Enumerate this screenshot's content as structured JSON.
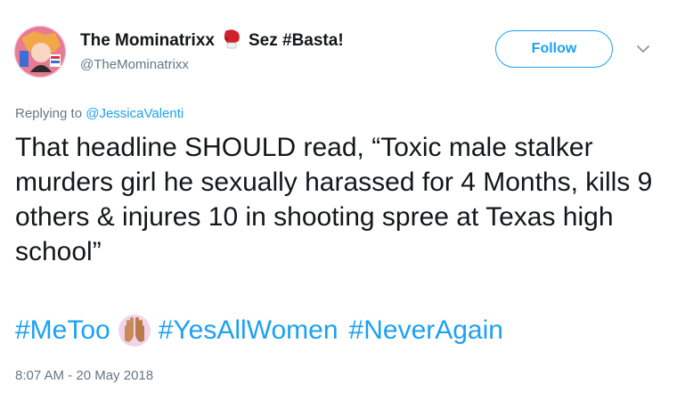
{
  "author": {
    "display_name": "The Mominatrixx",
    "name_suffix": "Sez #Basta!",
    "handle": "@TheMominatrixx",
    "avatar_icon": "avatar-woman-photo",
    "name_emoji_icon": "boxing-glove-icon"
  },
  "follow_button": {
    "label": "Follow"
  },
  "menu": {
    "icon": "chevron-down-icon"
  },
  "reply": {
    "prefix": "Replying to",
    "mention": "@JessicaValenti"
  },
  "tweet": {
    "text": "That headline SHOULD read, “Toxic male stalker murders girl he sexually harassed for 4 Months, kills 9 others & injures 10 in shooting spree at Texas high school”",
    "hashtags": [
      "#MeToo",
      "#YesAllWomen",
      "#NeverAgain"
    ],
    "emoji_icon": "raised-hands-icon",
    "timestamp": "8:07 AM - 20 May 2018"
  },
  "colors": {
    "link": "#1da1f2",
    "secondary_text": "#657786",
    "primary_text": "#14171a"
  }
}
